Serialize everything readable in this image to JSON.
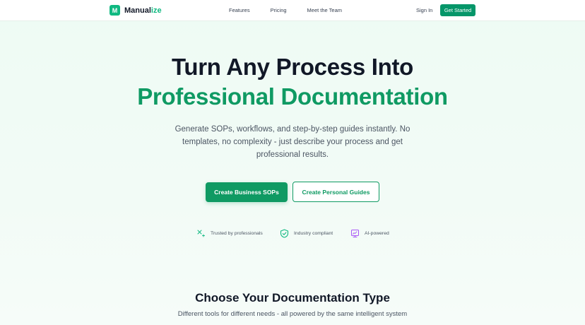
{
  "nav": {
    "logo_letter": "M",
    "logo_text_main": "Manual",
    "logo_text_accent": "ize",
    "links": [
      {
        "label": "Features"
      },
      {
        "label": "Pricing"
      },
      {
        "label": "Meet the Team"
      }
    ],
    "sign_in": "Sign In",
    "get_started": "Get Started"
  },
  "hero": {
    "title_line_1": "Turn Any Process Into",
    "title_line_2": "Professional Documentation",
    "subtitle": "Generate SOPs, workflows, and step-by-step guides instantly. No templates, no complexity - just describe your process and get professional results.",
    "primary_button": "Create Business SOPs",
    "secondary_button": "Create Personal Guides"
  },
  "badges": [
    {
      "icon": "sparkle-icon",
      "label": "Trusted by professionals"
    },
    {
      "icon": "shield-check-icon",
      "label": "Industry compliant"
    },
    {
      "icon": "ai-monitor-icon",
      "label": "AI-powered"
    }
  ],
  "section": {
    "title": "Choose Your Documentation Type",
    "subtitle": "Different tools for different needs - all powered by the same intelligent system"
  },
  "colors": {
    "brand": "#10b981",
    "brand_dark": "#0f9a63",
    "ai_icon": "#a855f7"
  }
}
